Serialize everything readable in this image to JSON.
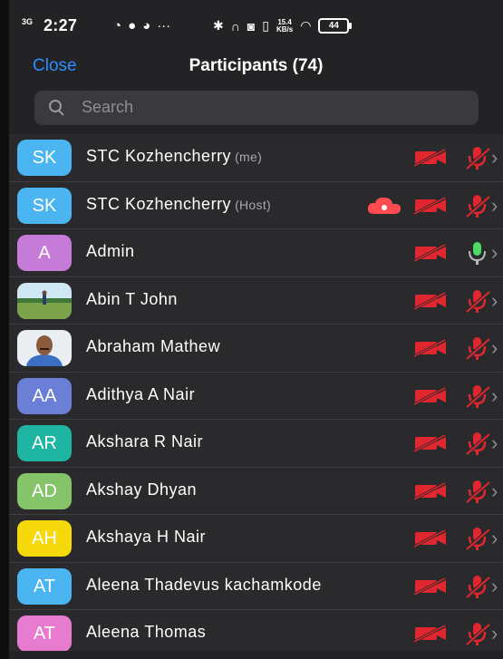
{
  "status_bar": {
    "network": "3G",
    "time": "2:27",
    "speed_value": "15.4",
    "speed_unit": "KB/s",
    "battery": "44"
  },
  "header": {
    "close_label": "Close",
    "title": "Participants (74)"
  },
  "search": {
    "placeholder": "Search"
  },
  "participants": [
    {
      "name": "STC Kozhencherry",
      "tag": "(me)",
      "initials": "SK",
      "avatar_color": "#4ab5f0",
      "cloud": false,
      "camera": "off",
      "mic": "muted"
    },
    {
      "name": "STC Kozhencherry",
      "tag": "(Host)",
      "initials": "SK",
      "avatar_color": "#4ab5f0",
      "cloud": true,
      "camera": "off",
      "mic": "muted"
    },
    {
      "name": "Admin",
      "tag": "",
      "initials": "A",
      "avatar_color": "#c77bd9",
      "cloud": false,
      "camera": "off",
      "mic": "on"
    },
    {
      "name": "Abin T John",
      "tag": "",
      "initials": "",
      "avatar_photo": "landscape",
      "cloud": false,
      "camera": "off",
      "mic": "muted"
    },
    {
      "name": "Abraham Mathew",
      "tag": "",
      "initials": "",
      "avatar_photo": "portrait",
      "cloud": false,
      "camera": "off",
      "mic": "muted"
    },
    {
      "name": "Adithya A Nair",
      "tag": "",
      "initials": "AA",
      "avatar_color": "#6b7fd7",
      "cloud": false,
      "camera": "off",
      "mic": "muted"
    },
    {
      "name": "Akshara R Nair",
      "tag": "",
      "initials": "AR",
      "avatar_color": "#1fb5a3",
      "cloud": false,
      "camera": "off",
      "mic": "muted"
    },
    {
      "name": "Akshay Dhyan",
      "tag": "",
      "initials": "AD",
      "avatar_color": "#86c46a",
      "cloud": false,
      "camera": "off",
      "mic": "muted"
    },
    {
      "name": "Akshaya H Nair",
      "tag": "",
      "initials": "AH",
      "avatar_color": "#f5d90a",
      "cloud": false,
      "camera": "off",
      "mic": "muted"
    },
    {
      "name": "Aleena Thadevus kachamkode",
      "tag": "",
      "initials": "AT",
      "avatar_color": "#4ab5f0",
      "cloud": false,
      "camera": "off",
      "mic": "muted"
    },
    {
      "name": "Aleena Thomas",
      "tag": "",
      "initials": "AT",
      "avatar_color": "#e77bd0",
      "cloud": false,
      "camera": "off",
      "mic": "muted"
    }
  ],
  "colors": {
    "accent": "#2d8cff",
    "muted_red": "#e0262f",
    "mic_green": "#4cd964"
  }
}
